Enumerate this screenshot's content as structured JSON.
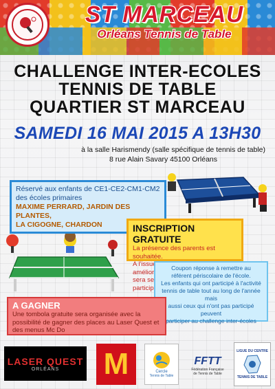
{
  "header": {
    "club_name": "ST MARCEAU",
    "club_subtitle": "Orléans Tennis de Table"
  },
  "title": {
    "line1": "CHALLENGE INTER-ECOLES",
    "line2": "TENNIS DE TABLE",
    "line3": "QUARTIER ST MARCEAU"
  },
  "event": {
    "date": "SAMEDI 16 MAI 2015 A 13H30",
    "venue_line1": "à la salle Harismendy (salle spécifique de tennis de table)",
    "venue_line2": "8 rue Alain Savary 45100 Orléans"
  },
  "schools_box": {
    "line1": "Réservé aux enfants de CE1-CE2-CM1-CM2",
    "line2": "des écoles primaires",
    "line3": "MAXIME PERRARD, JARDIN DES PLANTES,",
    "line4": "LA CIGOGNE, CHARDON"
  },
  "inscription_box": {
    "heading": "INSCRIPTION GRATUITE",
    "line1": "La présence des parents est souhaitée.",
    "line2": "A l'issue de l'événement un goûter amélioré",
    "line3": "sera servi à l'ensemble des participants."
  },
  "coupon_box": {
    "line1": "Coupon réponse à remettre au",
    "line2": "référent périscolaire de l'école.",
    "line3": "Les enfants qui ont participé à l'activité",
    "line4": "tennis de table tout au long de l'année mais",
    "line5": "aussi ceux qui n'ont pas participé peuvent",
    "line6": "participer au challenge inter-écoles"
  },
  "prize_box": {
    "heading": "A GAGNER",
    "line1": "Une tombola gratuite sera organisée avec la",
    "line2": "possibilité de gagner des places au Laser Quest et",
    "line3": "des menus Mc Do"
  },
  "sponsors": {
    "laser_quest": "LASER QUEST",
    "laser_quest_sub": "ORLÉANS",
    "mcdo": "M",
    "cercle": "Cercle",
    "cercle_sub": "Tennis de Table",
    "fftt": "FFTT",
    "fftt_sub1": "Fédération Française",
    "fftt_sub2": "de Tennis de Table",
    "ligue1": "LIGUE DU CENTRE",
    "ligue2": "TENNIS DE TABLE"
  },
  "colors": {
    "brand_red": "#d6172c",
    "date_blue": "#1c48b6"
  }
}
